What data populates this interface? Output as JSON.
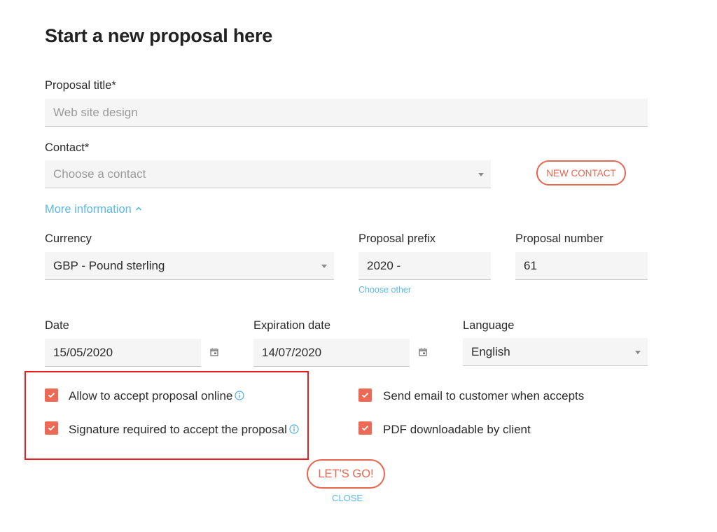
{
  "page": {
    "title": "Start a new proposal here"
  },
  "form": {
    "proposal_title": {
      "label": "Proposal title*",
      "value": "",
      "placeholder": "Web site design"
    },
    "contact": {
      "label": "Contact*",
      "placeholder": "Choose a contact",
      "new_contact_label": "NEW CONTACT"
    },
    "more_information_label": "More information",
    "more_information_icon": "chevron-up-icon",
    "currency": {
      "label": "Currency",
      "value": "GBP - Pound sterling"
    },
    "proposal_prefix": {
      "label": "Proposal prefix",
      "value": "2020 -",
      "choose_other_label": "Choose other"
    },
    "proposal_number": {
      "label": "Proposal number",
      "value": "61"
    },
    "date": {
      "label": "Date",
      "value": "15/05/2020",
      "icon": "calendar-icon"
    },
    "expiration_date": {
      "label": "Expiration date",
      "value": "14/07/2020",
      "icon": "calendar-icon"
    },
    "language": {
      "label": "Language",
      "value": "English"
    },
    "options": [
      {
        "label": "Allow to accept proposal online",
        "checked": true,
        "info": true
      },
      {
        "label": "Signature required to accept the proposal",
        "checked": true,
        "info": true
      },
      {
        "label": "Send email to customer when accepts",
        "checked": true,
        "info": false
      },
      {
        "label": "PDF downloadable by client",
        "checked": true,
        "info": false
      }
    ]
  },
  "actions": {
    "submit_label": "LET'S GO!",
    "close_label": "CLOSE"
  },
  "colors": {
    "accent": "#e8654f",
    "checkbox": "#ec6a55",
    "link": "#5bb8e8",
    "highlight": "#ee1c1c",
    "field_bg": "#f5f5f5"
  }
}
